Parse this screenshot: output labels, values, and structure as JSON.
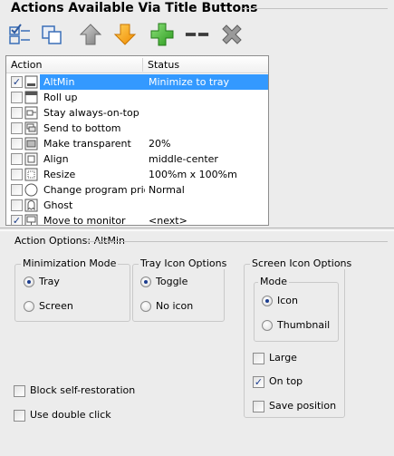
{
  "header": {
    "title": "Actions Available Via Title Buttons"
  },
  "toolbar": {
    "buttons": [
      {
        "icon": "checklist-icon"
      },
      {
        "icon": "window-stack-icon"
      },
      {
        "icon": "arrow-up-icon"
      },
      {
        "icon": "arrow-down-icon"
      },
      {
        "icon": "plus-icon"
      },
      {
        "icon": "separator-icon"
      },
      {
        "icon": "delete-icon"
      }
    ]
  },
  "list": {
    "columns": [
      "Action",
      "Status"
    ],
    "rows": [
      {
        "checked": true,
        "icon": "altmin-icon",
        "action": "AltMin",
        "status": "Minimize to tray",
        "selected": true
      },
      {
        "checked": false,
        "icon": "rollup-icon",
        "action": "Roll up",
        "status": ""
      },
      {
        "checked": false,
        "icon": "pin-icon",
        "action": "Stay always-on-top",
        "status": ""
      },
      {
        "checked": false,
        "icon": "send-bottom-icon",
        "action": "Send to bottom",
        "status": ""
      },
      {
        "checked": false,
        "icon": "transparent-icon",
        "action": "Make transparent",
        "status": "20%"
      },
      {
        "checked": false,
        "icon": "align-icon",
        "action": "Align",
        "status": "middle-center"
      },
      {
        "checked": false,
        "icon": "resize-icon",
        "action": "Resize",
        "status": "100%m x 100%m"
      },
      {
        "checked": false,
        "icon": "priority-icon",
        "action": "Change program prio...",
        "status": "Normal"
      },
      {
        "checked": false,
        "icon": "ghost-icon",
        "action": "Ghost",
        "status": ""
      },
      {
        "checked": true,
        "icon": "monitor-icon",
        "action": "Move to monitor",
        "status": "<next>"
      }
    ]
  },
  "options": {
    "title": "Action Options: AltMin",
    "minimization": {
      "label": "Minimization Mode",
      "tray": "Tray",
      "screen": "Screen",
      "selected": "Tray"
    },
    "tray_icon": {
      "label": "Tray Icon Options",
      "toggle": "Toggle",
      "no_icon": "No icon",
      "selected": "Toggle"
    },
    "screen_icon": {
      "label": "Screen Icon Options",
      "mode_label": "Mode",
      "icon": "Icon",
      "thumbnail": "Thumbnail",
      "selected": "Icon",
      "large": "Large",
      "large_checked": false,
      "on_top": "On top",
      "on_top_checked": true,
      "save_position": "Save position",
      "save_position_checked": false
    },
    "block_self_restoration": "Block self-restoration",
    "block_checked": false,
    "use_double_click": "Use double click",
    "double_checked": false
  }
}
